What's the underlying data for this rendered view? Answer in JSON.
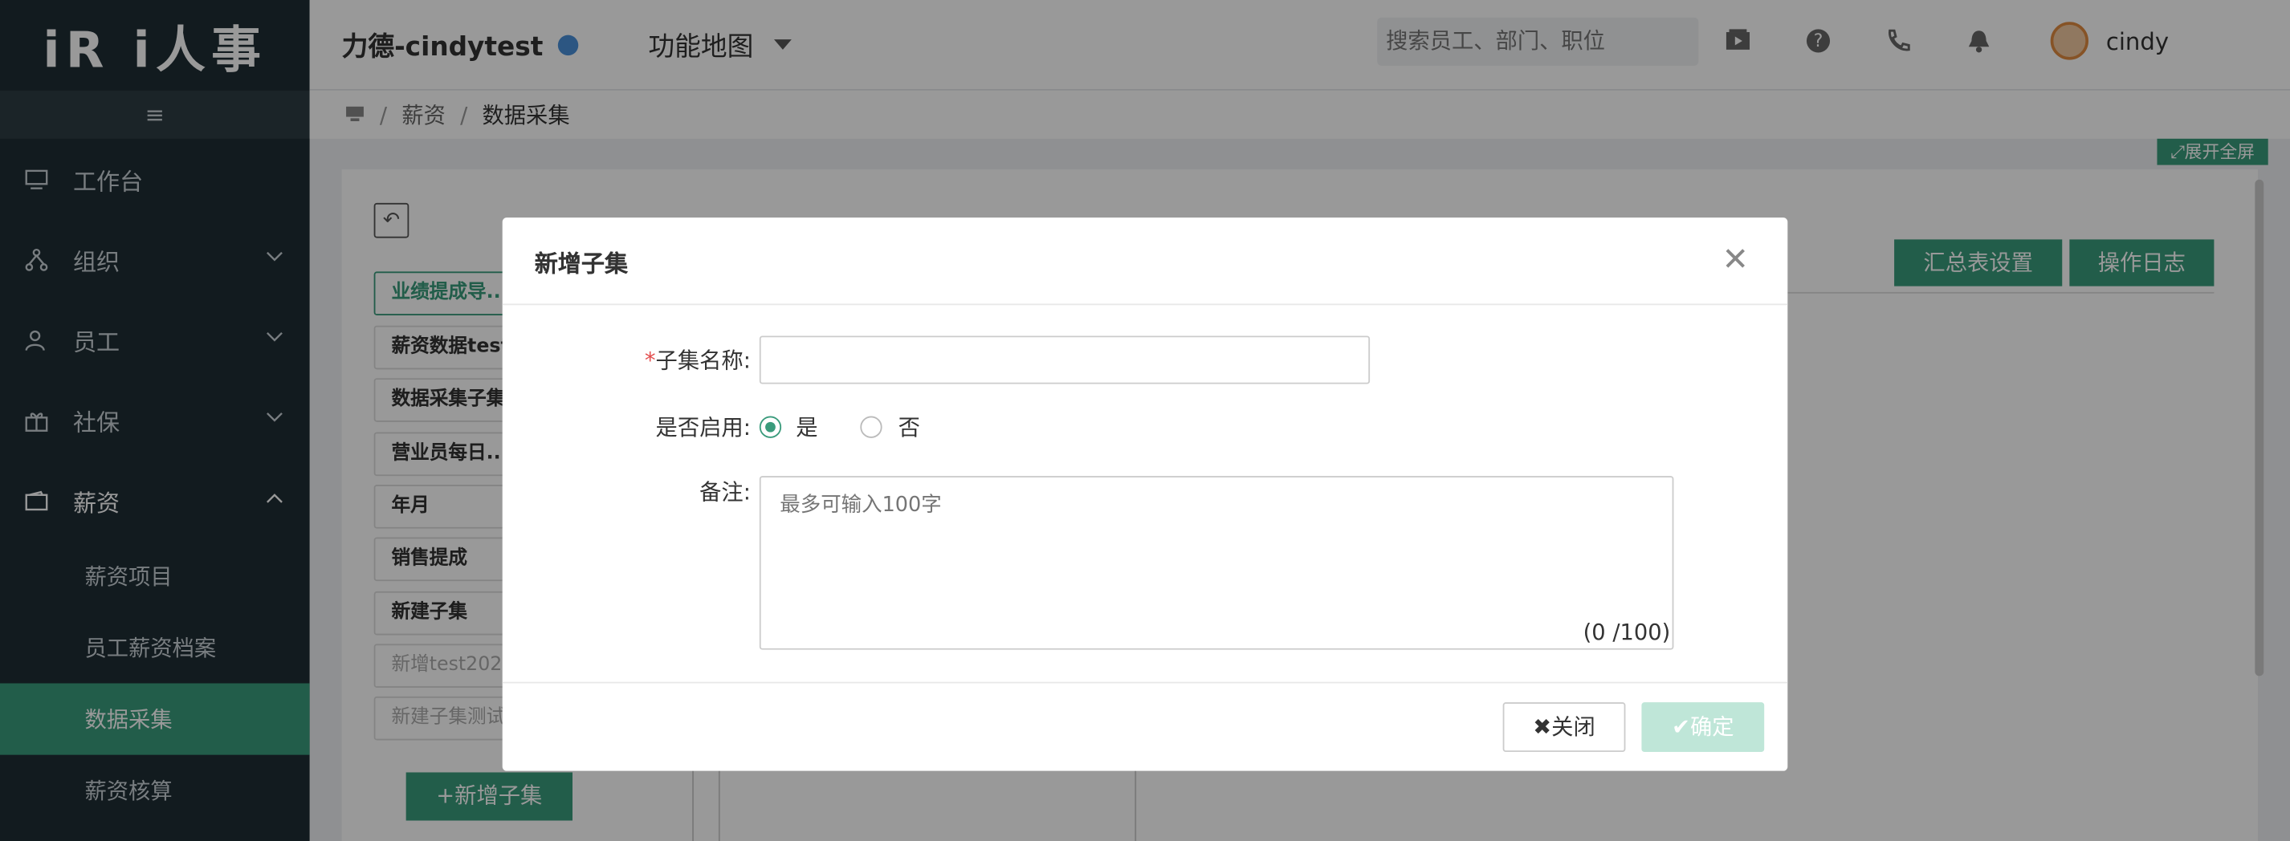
{
  "app": {
    "logo": "iR i人事",
    "menu_toggle": "≡"
  },
  "sidebar": {
    "items": [
      {
        "label": "工作台"
      },
      {
        "label": "组织"
      },
      {
        "label": "员工"
      },
      {
        "label": "社保"
      },
      {
        "label": "薪资"
      }
    ],
    "sub_items": [
      {
        "label": "薪资项目"
      },
      {
        "label": "员工薪资档案"
      },
      {
        "label": "数据采集"
      },
      {
        "label": "薪资核算"
      }
    ]
  },
  "header": {
    "company": "力德-cindytest",
    "func_map": "功能地图",
    "search_placeholder": "搜索员工、部门、职位",
    "username": "cindy"
  },
  "breadcrumb": {
    "item1": "薪资",
    "item2": "数据采集",
    "sep": "/"
  },
  "expand_label": "展开全屏",
  "subsets": [
    {
      "label": "业绩提成导..."
    },
    {
      "label": "薪资数据test"
    },
    {
      "label": "数据采集子集"
    },
    {
      "label": "营业员每日..."
    },
    {
      "label": "年月"
    },
    {
      "label": "销售提成"
    },
    {
      "label": "新建子集"
    },
    {
      "label": "新增test202"
    },
    {
      "label": "新建子集测试"
    }
  ],
  "add_subset_btn": "新增子集",
  "toolbar": {
    "summary": "汇总表设置",
    "log": "操作日志"
  },
  "modal": {
    "title": "新增子集",
    "name_label": "子集名称:",
    "required_mark": "*",
    "enable_label": "是否启用:",
    "yes": "是",
    "no": "否",
    "enabled": true,
    "remark_label": "备注:",
    "remark_placeholder": "最多可输入100字",
    "counter": "(0 /100)",
    "close_btn": "关闭",
    "ok_btn": "确定"
  },
  "colors": {
    "accent": "#3a9b7c",
    "sidebar_bg": "#1f2d35"
  }
}
